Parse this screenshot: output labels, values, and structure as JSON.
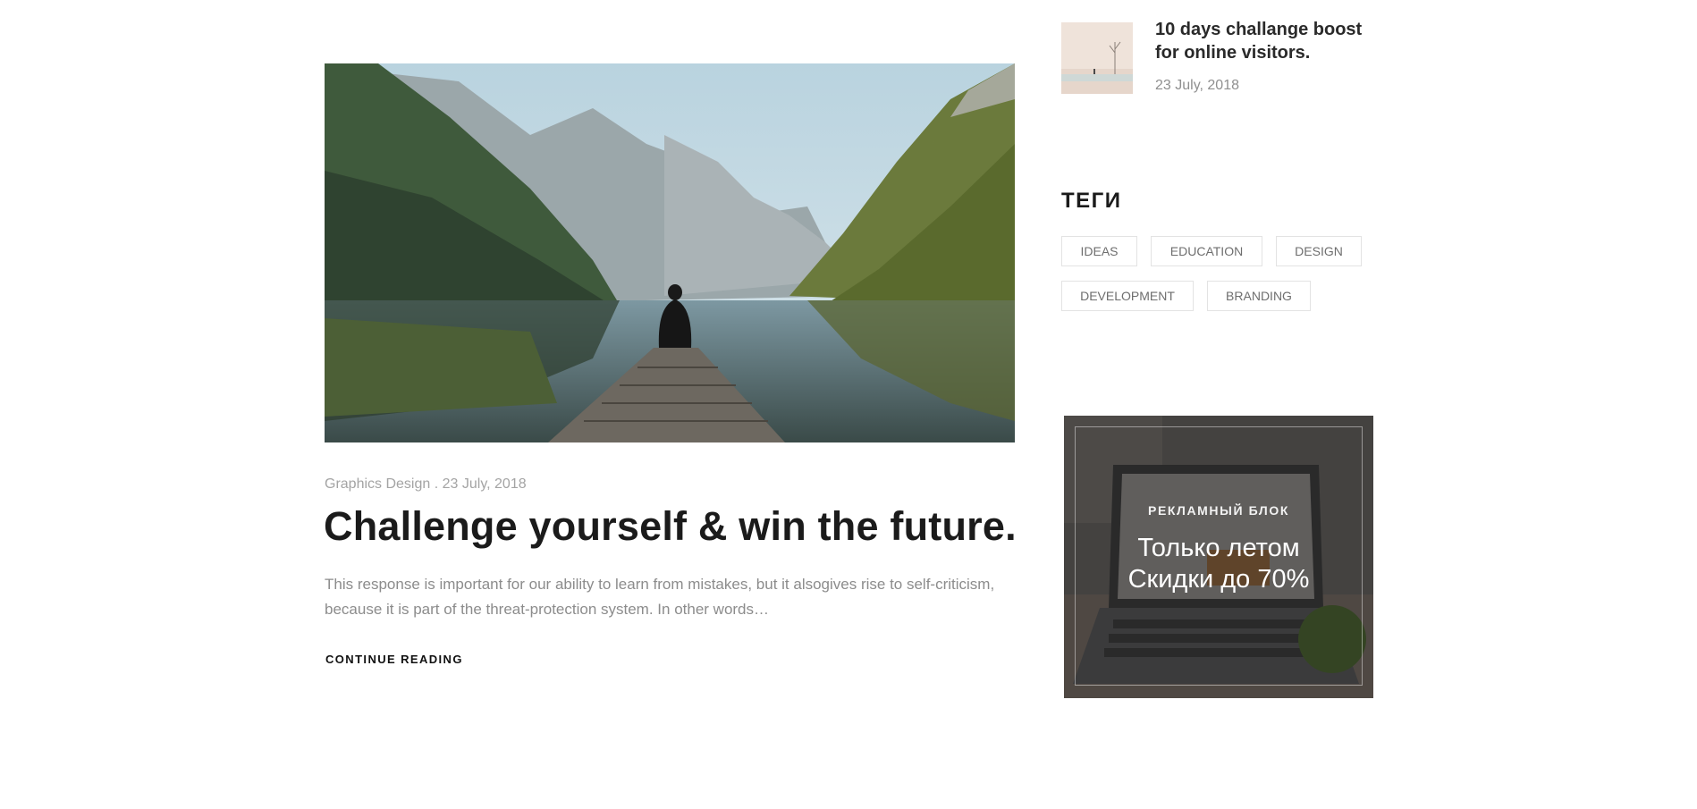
{
  "post": {
    "category": "Graphics Design",
    "meta_separator": " . ",
    "date": "23 July, 2018",
    "title": "Challenge yourself & win the future.",
    "excerpt": "This response is important for our ability to learn from mistakes, but it alsogives rise to self-criticism, because it is part of the threat-protection system. In other words…",
    "continue_label": "CONTINUE READING"
  },
  "sidebar": {
    "recent_post": {
      "title": "10 days challange boost for online visitors.",
      "date": "23 July, 2018"
    },
    "tags": {
      "heading": "ТЕГИ",
      "items": [
        "IDEAS",
        "EDUCATION",
        "DESIGN",
        "DEVELOPMENT",
        "BRANDING"
      ]
    },
    "ad": {
      "label": "РЕКЛАМНЫЙ БЛОК",
      "line1": "Только летом",
      "line2": "Скидки до 70%"
    }
  },
  "colors": {
    "title": "#1b1b1b",
    "meta": "#a4a4a4",
    "excerpt": "#8c8c8c",
    "tag_border": "#e3e3e3",
    "ad_overlay": "#3a3a3a"
  }
}
